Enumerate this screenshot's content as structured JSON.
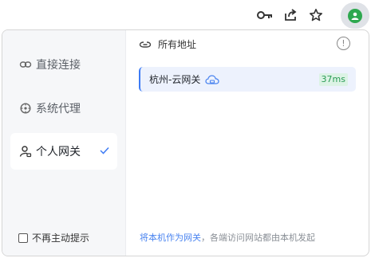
{
  "toolbar": {
    "icons": [
      "key-icon",
      "share-icon",
      "star-icon",
      "extension-icon"
    ],
    "extension_color": "#2ea84f"
  },
  "sidebar": {
    "items": [
      {
        "label": "直接连接",
        "icon": "link-icon"
      },
      {
        "label": "系统代理",
        "icon": "proxy-icon"
      },
      {
        "label": "个人网关",
        "icon": "user-gateway-icon",
        "selected": true
      }
    ],
    "no_prompt_label": "不再主动提示",
    "no_prompt_checked": false
  },
  "main": {
    "header_label": "所有地址",
    "gateways": [
      {
        "name": "杭州-云网关",
        "latency": "37ms",
        "icon": "cloud-icon"
      }
    ],
    "footer_link": "将本机作为网关",
    "footer_text": "，各端访问网站都由本机发起"
  },
  "colors": {
    "accent": "#3d7bf5",
    "latency_bg": "#dcf3e5",
    "latency_text": "#2a9c55"
  }
}
